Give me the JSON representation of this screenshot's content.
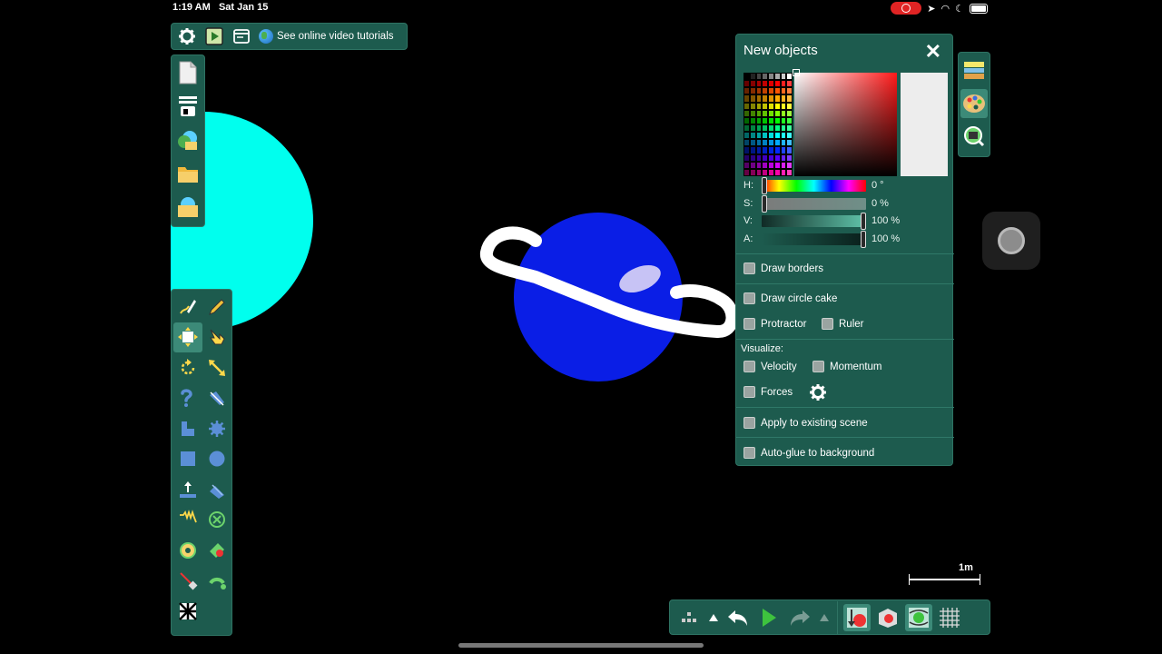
{
  "status_bar": {
    "time": "1:19 AM",
    "date": "Sat Jan 15"
  },
  "top_toolbar": {
    "tutorials_label": "See online video tutorials",
    "icons": [
      "gear-icon",
      "play-scene-icon",
      "window-icon",
      "globe-icon"
    ]
  },
  "file_bar": {
    "icons": [
      "new-scene-icon",
      "open-scenes-list-icon",
      "algobox-browser-icon",
      "open-folder-icon",
      "save-folder-icon"
    ]
  },
  "tools": {
    "items": [
      "sketch-tool",
      "pencil-tool",
      "move-tool",
      "drag-hand-tool",
      "rotate-tool",
      "scale-tool",
      "chain-tool",
      "knife-tool",
      "polygon-tool",
      "gear-tool",
      "box-tool",
      "circle-tool",
      "plane-tool",
      "brush-tool",
      "spring-tool",
      "fixate-tool",
      "hinge-tool",
      "tracer-tool",
      "laser-tool",
      "thruster-tool",
      "texture-tool"
    ],
    "selected": "move-tool"
  },
  "new_objects_panel": {
    "title": "New objects",
    "sliders": [
      {
        "label": "H:",
        "value": "0 °",
        "fraction": 0.0
      },
      {
        "label": "S:",
        "value": "0 %",
        "fraction": 0.0
      },
      {
        "label": "V:",
        "value": "100 %",
        "fraction": 1.0
      },
      {
        "label": "A:",
        "value": "100 %",
        "fraction": 1.0
      }
    ],
    "options": {
      "draw_borders": "Draw borders",
      "draw_circle_cake": "Draw circle cake",
      "protractor": "Protractor",
      "ruler": "Ruler",
      "visualize": "Visualize:",
      "velocity": "Velocity",
      "momentum": "Momentum",
      "forces": "Forces",
      "apply_existing": "Apply to existing scene",
      "auto_glue": "Auto-glue to background"
    },
    "selected_color": "#ededed"
  },
  "side_tabs": [
    "scene-layers-icon",
    "palette-icon",
    "zoom-icon"
  ],
  "scale": {
    "label": "1m"
  },
  "bottom_toolbar": {
    "icons": [
      "grid-dots-icon",
      "collapse-up-icon",
      "undo-icon",
      "play-icon",
      "redo-icon",
      "expand-up-icon",
      "gravity-icon",
      "air-friction-icon",
      "controller-icon",
      "grid-icon"
    ]
  },
  "colors": {
    "panel": "#1d5b4e",
    "canvas": "#000000",
    "cyan_circle": "#00ffee",
    "blue_planet": "#0a1ee6",
    "ring": "#ffffff",
    "planet_spot": "#c7c3f5"
  }
}
